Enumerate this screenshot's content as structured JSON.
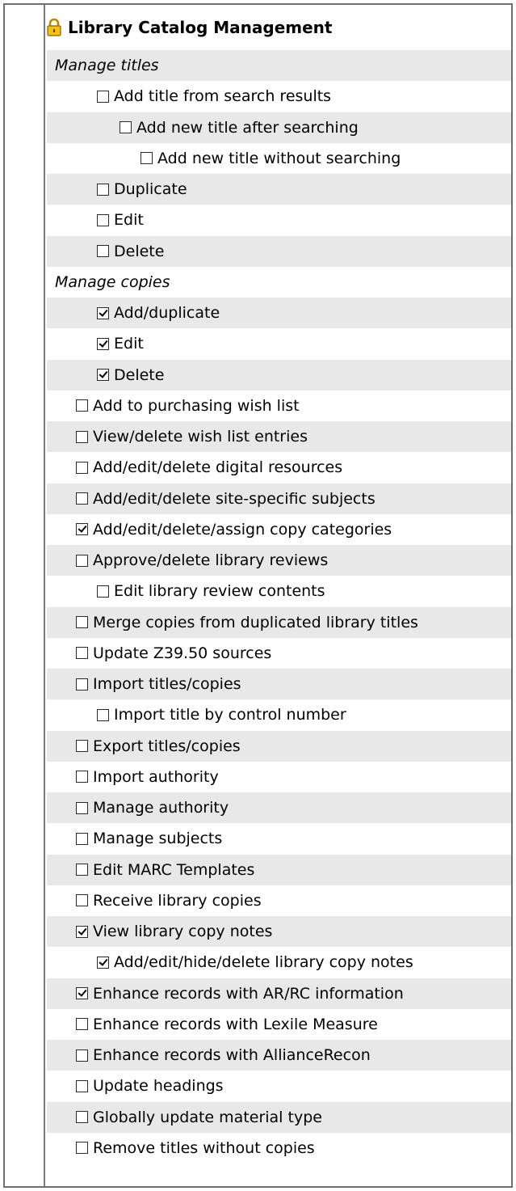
{
  "panel": {
    "title": "Library Catalog Management",
    "icon": "lock-icon",
    "rows": [
      {
        "kind": "section",
        "label": "Manage titles",
        "level": 0
      },
      {
        "kind": "check",
        "label": "Add title from search results",
        "checked": false,
        "level": 2
      },
      {
        "kind": "check",
        "label": "Add new title after searching",
        "checked": false,
        "level": 3
      },
      {
        "kind": "check",
        "label": "Add new title without searching",
        "checked": false,
        "level": 4
      },
      {
        "kind": "check",
        "label": "Duplicate",
        "checked": false,
        "level": 2
      },
      {
        "kind": "check",
        "label": "Edit",
        "checked": false,
        "level": 2
      },
      {
        "kind": "check",
        "label": "Delete",
        "checked": false,
        "level": 2
      },
      {
        "kind": "section",
        "label": "Manage copies",
        "level": 0
      },
      {
        "kind": "check",
        "label": "Add/duplicate",
        "checked": true,
        "level": 2
      },
      {
        "kind": "check",
        "label": "Edit",
        "checked": true,
        "level": 2
      },
      {
        "kind": "check",
        "label": "Delete",
        "checked": true,
        "level": 2
      },
      {
        "kind": "check",
        "label": "Add to purchasing wish list",
        "checked": false,
        "level": 1
      },
      {
        "kind": "check",
        "label": "View/delete wish list entries",
        "checked": false,
        "level": 1
      },
      {
        "kind": "check",
        "label": "Add/edit/delete digital resources",
        "checked": false,
        "level": 1
      },
      {
        "kind": "check",
        "label": "Add/edit/delete site-specific subjects",
        "checked": false,
        "level": 1
      },
      {
        "kind": "check",
        "label": "Add/edit/delete/assign copy categories",
        "checked": true,
        "level": 1
      },
      {
        "kind": "check",
        "label": "Approve/delete library reviews",
        "checked": false,
        "level": 1
      },
      {
        "kind": "check",
        "label": "Edit library review contents",
        "checked": false,
        "level": 2
      },
      {
        "kind": "check",
        "label": "Merge copies from duplicated library titles",
        "checked": false,
        "level": 1
      },
      {
        "kind": "check",
        "label": "Update Z39.50 sources",
        "checked": false,
        "level": 1
      },
      {
        "kind": "check",
        "label": "Import titles/copies",
        "checked": false,
        "level": 1
      },
      {
        "kind": "check",
        "label": "Import title by control number",
        "checked": false,
        "level": 2
      },
      {
        "kind": "check",
        "label": "Export titles/copies",
        "checked": false,
        "level": 1
      },
      {
        "kind": "check",
        "label": "Import authority",
        "checked": false,
        "level": 1
      },
      {
        "kind": "check",
        "label": "Manage authority",
        "checked": false,
        "level": 1
      },
      {
        "kind": "check",
        "label": "Manage subjects",
        "checked": false,
        "level": 1
      },
      {
        "kind": "check",
        "label": "Edit MARC Templates",
        "checked": false,
        "level": 1
      },
      {
        "kind": "check",
        "label": "Receive library copies",
        "checked": false,
        "level": 1
      },
      {
        "kind": "check",
        "label": "View library copy notes",
        "checked": true,
        "level": 1
      },
      {
        "kind": "check",
        "label": "Add/edit/hide/delete library copy notes",
        "checked": true,
        "level": 2
      },
      {
        "kind": "check",
        "label": "Enhance records with AR/RC information",
        "checked": true,
        "level": 1
      },
      {
        "kind": "check",
        "label": "Enhance records with Lexile Measure",
        "checked": false,
        "level": 1
      },
      {
        "kind": "check",
        "label": "Enhance records with AllianceRecon",
        "checked": false,
        "level": 1
      },
      {
        "kind": "check",
        "label": "Update headings",
        "checked": false,
        "level": 1
      },
      {
        "kind": "check",
        "label": "Globally update material type",
        "checked": false,
        "level": 1
      },
      {
        "kind": "check",
        "label": "Remove titles without copies",
        "checked": false,
        "level": 1
      }
    ]
  }
}
